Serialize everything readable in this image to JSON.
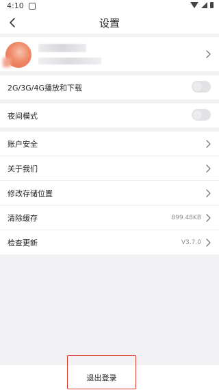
{
  "status_bar": {
    "time": "4:10"
  },
  "header": {
    "title": "设置",
    "back_icon": "back-arrow-icon"
  },
  "profile": {
    "name": "",
    "uid": ""
  },
  "network_row": {
    "label": "2G/3G/4G播放和下载",
    "toggle_on": false
  },
  "night_row": {
    "label": "夜间模式",
    "toggle_on": false
  },
  "menu_rows": [
    {
      "label": "账户安全",
      "value": ""
    },
    {
      "label": "关于我们",
      "value": ""
    },
    {
      "label": "修改存储位置",
      "value": ""
    },
    {
      "label": "清除缓存",
      "value": "899.48KB"
    },
    {
      "label": "检查更新",
      "value": "V3.7.0"
    }
  ],
  "logout": {
    "label": "退出登录"
  },
  "colors": {
    "highlight": "#e0352b",
    "avatar": "#f08a68"
  }
}
